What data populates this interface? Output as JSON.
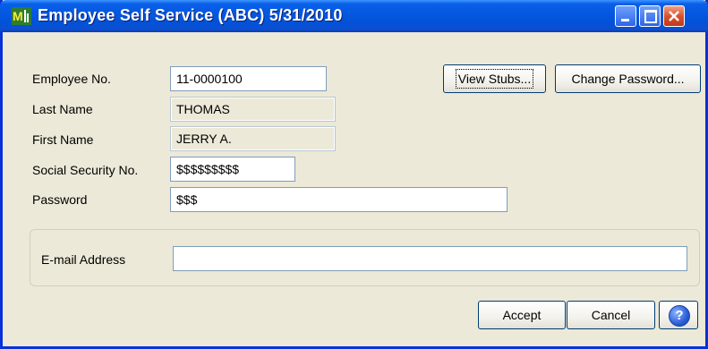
{
  "window": {
    "title": "Employee Self Service (ABC) 5/31/2010",
    "app_icon": "mas90-app-icon",
    "controls": {
      "minimize_icon": "minimize-icon",
      "maximize_icon": "maximize-icon",
      "close_icon": "close-icon"
    }
  },
  "form": {
    "employee_no": {
      "label": "Employee No.",
      "value": "11-0000100"
    },
    "last_name": {
      "label": "Last Name",
      "value": "THOMAS"
    },
    "first_name": {
      "label": "First Name",
      "value": "JERRY A."
    },
    "ssn": {
      "label": "Social Security No.",
      "value": "$$$$$$$$$"
    },
    "password": {
      "label": "Password",
      "value": "$$$"
    },
    "email": {
      "label": "E-mail Address",
      "value": ""
    }
  },
  "buttons": {
    "view_stubs": {
      "label": "View Stubs...",
      "mnemonic": "V"
    },
    "change_password": {
      "label": "Change Password...",
      "mnemonic": "P"
    },
    "accept": {
      "label": "Accept",
      "mnemonic": "A"
    },
    "cancel": {
      "label": "Cancel",
      "mnemonic": "C"
    },
    "help_icon": "help-icon"
  },
  "colors": {
    "titlebar": "#0558e0",
    "window_bg": "#ece9d8",
    "field_border": "#7f9db9"
  }
}
